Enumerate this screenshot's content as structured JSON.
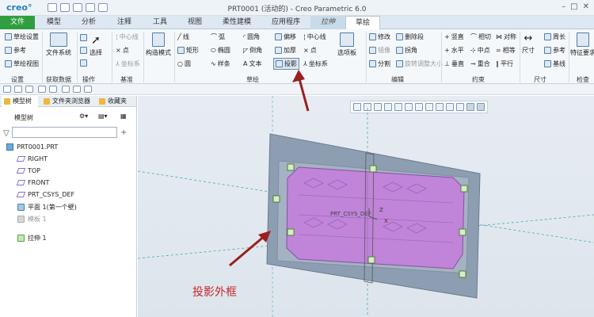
{
  "app": {
    "logo": "creo°",
    "title": "PRT0001 (活动的) - Creo Parametric 6.0"
  },
  "tabs": [
    "文件",
    "模型",
    "分析",
    "注释",
    "工具",
    "视图",
    "柔性建模",
    "应用程序",
    "拉伸",
    "草绘"
  ],
  "ribbon": {
    "settings": [
      "草绘设置",
      "参考",
      "草绘视图"
    ],
    "get_data": "文件系统",
    "ops": "选择",
    "datum": [
      "中心线",
      "点",
      "坐标系"
    ],
    "construction": "构造模式",
    "sketch_col1": [
      "线",
      "矩形",
      "圆"
    ],
    "sketch_col2": [
      "弧",
      "椭圆",
      "样条"
    ],
    "sketch_col3": [
      "圆角",
      "倒角",
      "文本"
    ],
    "sketch_col4": [
      "偏移",
      "加厚",
      "投影"
    ],
    "sketch_col5": [
      "中心线",
      "点",
      "坐标系"
    ],
    "palette": "选项板",
    "edit": [
      "修改",
      "删除段",
      "镜像",
      "拐角",
      "分割",
      "旋转调整大小"
    ],
    "constraint_col1": [
      "竖直",
      "水平",
      "垂直"
    ],
    "constraint_col2": [
      "相切",
      "中点",
      "重合"
    ],
    "constraint_col3": [
      "对称",
      "相等",
      "平行"
    ],
    "dims": [
      "尺寸",
      "周长",
      "参考",
      "基线"
    ],
    "inspect": "特征要求",
    "group_labels": [
      "设置",
      "获取数据",
      "操作",
      "基准",
      "草绘",
      "编辑",
      "约束",
      "尺寸",
      "检查"
    ]
  },
  "sidebar": {
    "tabs": [
      "模型树",
      "文件夹浏览器",
      "收藏夹"
    ],
    "header": "模型树",
    "tree": [
      "PRT0001.PRT",
      "RIGHT",
      "TOP",
      "FRONT",
      "PRT_CSYS_DEF",
      "平面 1(第一个壁)",
      "模板 1",
      "拉伸 1"
    ]
  },
  "viewport": {
    "csys_label": "PRT_CSYS_DEF",
    "axis_z": "Z",
    "axis_x": "X"
  },
  "annotation": {
    "text": "投影外框",
    "color": "#c62828"
  },
  "colors": {
    "accent": "#2e9e3e",
    "part_fill": "#c084d8",
    "plate_fill": "#8c9cb0"
  }
}
